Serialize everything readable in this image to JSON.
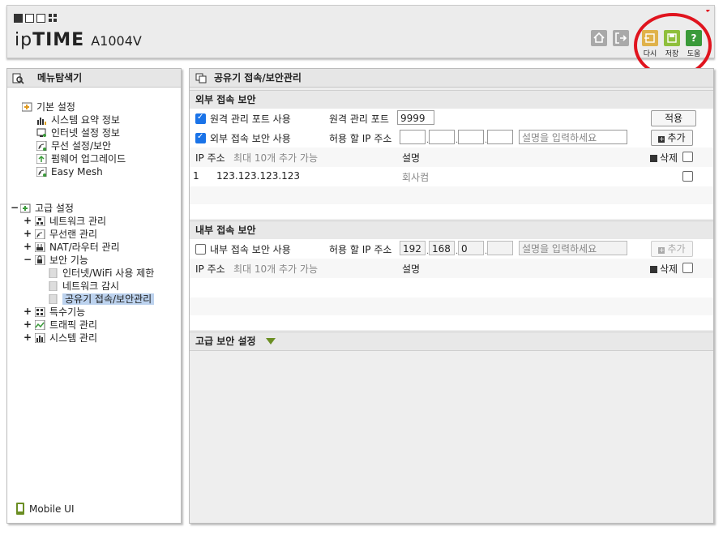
{
  "header": {
    "logo_prefix": "ip",
    "logo_bold": "TIME",
    "model": "A1004V",
    "buttons": [
      {
        "icon": "home-icon"
      },
      {
        "icon": "logout-icon"
      },
      {
        "icon": "reload-icon",
        "label": "다시"
      },
      {
        "icon": "save-icon",
        "label": "저장"
      },
      {
        "icon": "help-icon",
        "label": "도움"
      }
    ]
  },
  "left": {
    "title": "메뉴탐색기",
    "basic": {
      "label": "기본 설정",
      "items": [
        "시스템 요약 정보",
        "인터넷 설정 정보",
        "무선 설정/보안",
        "펌웨어 업그레이드",
        "Easy Mesh"
      ]
    },
    "advanced": {
      "label": "고급 설정",
      "items": [
        "네트워크 관리",
        "무선랜 관리",
        "NAT/라우터 관리",
        "보안 기능"
      ],
      "security_items": [
        "인터넷/WiFi 사용 제한",
        "네트워크 감시",
        "공유기 접속/보안관리"
      ],
      "more_items": [
        "특수기능",
        "트래픽 관리",
        "시스템 관리"
      ]
    },
    "mobile_ui": "Mobile UI"
  },
  "right": {
    "title": "공유기 접속/보안관리",
    "external": {
      "heading": "외부 접속 보안",
      "remote_port_label": "원격 관리 포트 사용",
      "remote_port_field_label": "원격 관리 포트",
      "remote_port_value": "9999",
      "apply": "적용",
      "ext_security_label": "외부 접속 보안 사용",
      "allow_ip_label": "허용 할 IP 주소",
      "desc_placeholder": "설명을 입력하세요",
      "add": "추가",
      "col_ip": "IP 주소",
      "col_max": "최대 10개 추가 가능",
      "col_desc": "설명",
      "col_delete": "삭제",
      "rows": [
        {
          "no": "1",
          "ip": "123.123.123.123",
          "desc": "회사컴"
        }
      ]
    },
    "internal": {
      "heading": "내부 접속 보안",
      "label": "내부 접속 보안 사용",
      "allow_ip_label": "허용 할 IP 주소",
      "ip1": "192",
      "ip2": "168",
      "ip3": "0",
      "desc_placeholder": "설명을 입력하세요",
      "add": "추가",
      "col_ip": "IP 주소",
      "col_max": "최대 10개 추가 가능",
      "col_desc": "설명",
      "col_delete": "삭제"
    },
    "advanced_heading": "고급 보안 설정"
  }
}
